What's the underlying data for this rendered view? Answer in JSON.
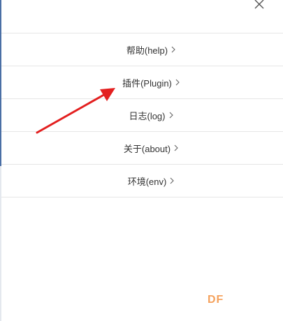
{
  "menu": {
    "items": [
      {
        "label": "帮助(help)"
      },
      {
        "label": "插件(Plugin)"
      },
      {
        "label": "日志(log)"
      },
      {
        "label": "关于(about)"
      },
      {
        "label": "环境(env)"
      }
    ]
  },
  "icons": {
    "close": "close-icon",
    "chevron": "chevron-right-icon"
  },
  "watermark": {
    "text": "DF"
  },
  "colors": {
    "arrow": "#e31f1f",
    "divider": "#e6e6e6",
    "text": "#333333",
    "watermark": "#f5a25d",
    "left_accent": "#4a6fa5"
  }
}
